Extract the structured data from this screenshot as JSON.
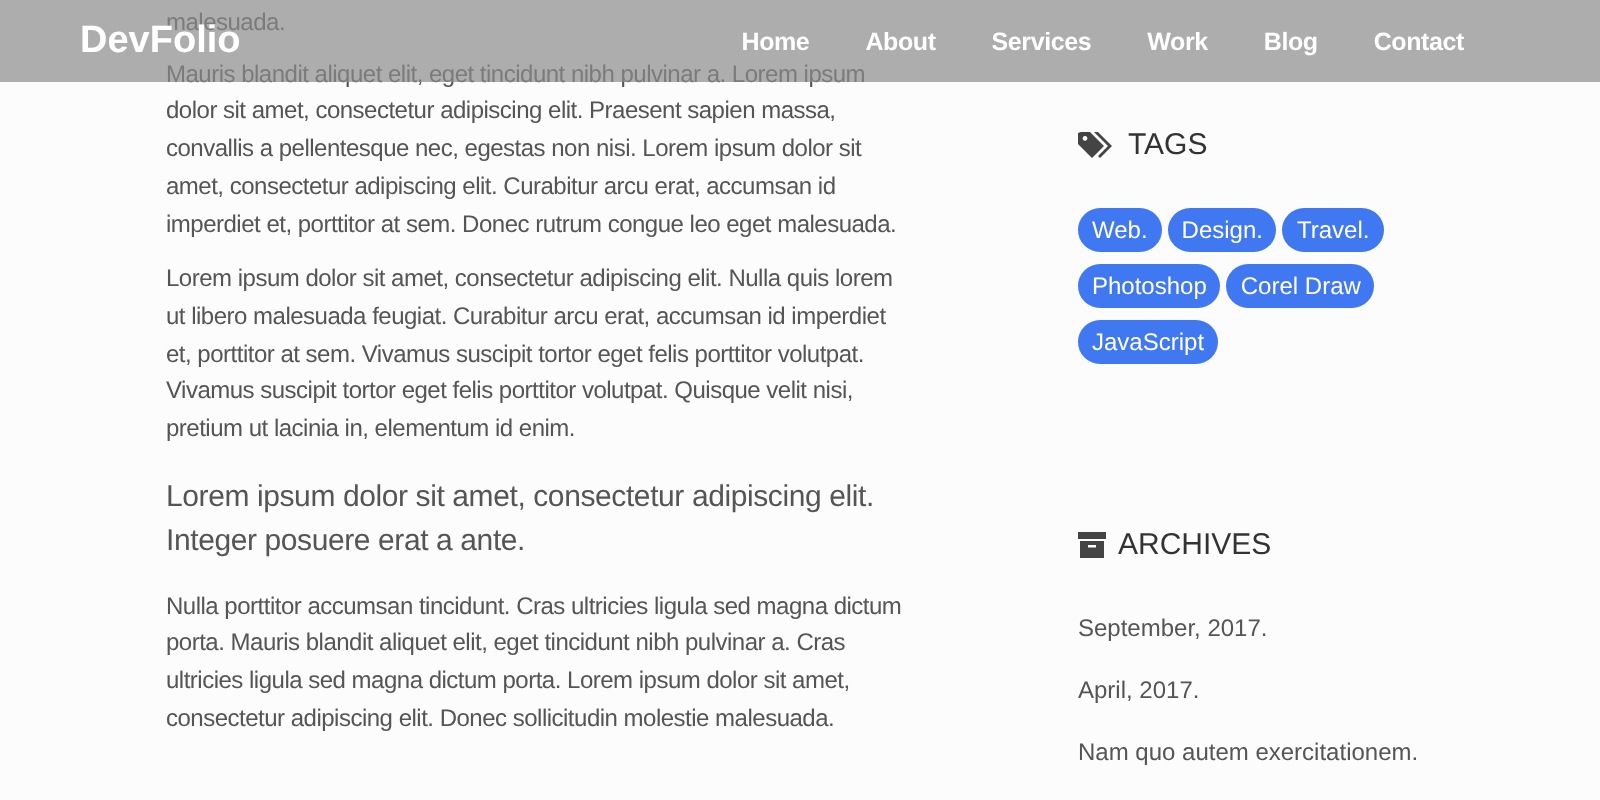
{
  "navbar": {
    "logo": "DevFolio",
    "links": [
      "Home",
      "About",
      "Services",
      "Work",
      "Blog",
      "Contact"
    ]
  },
  "article": {
    "blocks": [
      {
        "kind": "paragraph",
        "text": "malesuada."
      },
      {
        "kind": "paragraph",
        "text": "Mauris blandit aliquet elit, eget tincidunt nibh pulvinar a. Lorem ipsum dolor sit amet, consectetur adipiscing elit. Praesent sapien massa, convallis a pellentesque nec, egestas non nisi. Lorem ipsum dolor sit amet, consectetur adipiscing elit. Curabitur arcu erat, accumsan id imperdiet et, porttitor at sem. Donec rutrum congue leo eget malesuada."
      },
      {
        "kind": "paragraph",
        "text": "Lorem ipsum dolor sit amet, consectetur adipiscing elit. Nulla quis lorem ut libero malesuada feugiat. Curabitur arcu erat, accumsan id imperdiet et, porttitor at sem. Vivamus suscipit tortor eget felis porttitor volutpat. Vivamus suscipit tortor eget felis porttitor volutpat. Quisque velit nisi, pretium ut lacinia in, elementum id enim."
      },
      {
        "kind": "lead",
        "text": "Lorem ipsum dolor sit amet, consectetur adipiscing elit. Integer posuere erat a ante."
      },
      {
        "kind": "paragraph",
        "text": "Nulla porttitor accumsan tincidunt. Cras ultricies ligula sed magna dictum porta. Mauris blandit aliquet elit, eget tincidunt nibh pulvinar a. Cras ultricies ligula sed magna dictum porta. Lorem ipsum dolor sit amet, consectetur adipiscing elit. Donec sollicitudin molestie malesuada."
      }
    ]
  },
  "sidebar": {
    "tags": {
      "title": "TAGS",
      "items": [
        "Web.",
        "Design.",
        "Travel.",
        "Photoshop",
        "Corel Draw",
        "JavaScript"
      ]
    },
    "archives": {
      "title": "ARCHIVES",
      "items": [
        "September, 2017.",
        "April, 2017.",
        "Nam quo autem exercitationem."
      ]
    }
  }
}
